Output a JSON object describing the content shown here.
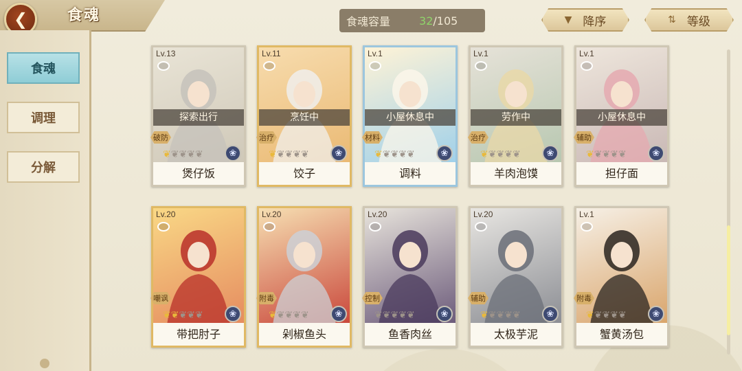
{
  "header": {
    "title": "食魂",
    "capacity_label": "食魂容量",
    "capacity_current": "32",
    "capacity_max": "/105",
    "sort_order_label": "降序",
    "sort_key_label": "等级"
  },
  "sidebar": {
    "items": [
      {
        "label": "食魂",
        "active": true
      },
      {
        "label": "调理",
        "active": false
      },
      {
        "label": "分解",
        "active": false
      }
    ]
  },
  "cards": [
    {
      "level": "Lv.13",
      "status": "探索出行",
      "role": "破防",
      "stars_lit": 1,
      "stars_total": 5,
      "name": "煲仔饭",
      "rarity": "grey"
    },
    {
      "level": "Lv.11",
      "status": "烹饪中",
      "role": "治疗",
      "stars_lit": 1,
      "stars_total": 5,
      "name": "饺子",
      "rarity": "gold"
    },
    {
      "level": "Lv.1",
      "status": "小屋休息中",
      "role": "材料",
      "stars_lit": 1,
      "stars_total": 5,
      "name": "调料",
      "rarity": "blue"
    },
    {
      "level": "Lv.1",
      "status": "劳作中",
      "role": "治疗",
      "stars_lit": 1,
      "stars_total": 5,
      "name": "羊肉泡馍",
      "rarity": "grey"
    },
    {
      "level": "Lv.1",
      "status": "小屋休息中",
      "role": "辅助",
      "stars_lit": 1,
      "stars_total": 5,
      "name": "担仔面",
      "rarity": "grey"
    },
    {
      "level": "Lv.20",
      "status": "",
      "role": "嘲讽",
      "stars_lit": 2,
      "stars_total": 5,
      "name": "带把肘子",
      "rarity": "gold"
    },
    {
      "level": "Lv.20",
      "status": "",
      "role": "附毒",
      "stars_lit": 1,
      "stars_total": 5,
      "name": "剁椒鱼头",
      "rarity": "gold"
    },
    {
      "level": "Lv.20",
      "status": "",
      "role": "控制",
      "stars_lit": 0,
      "stars_total": 5,
      "name": "鱼香肉丝",
      "rarity": "grey"
    },
    {
      "level": "Lv.20",
      "status": "",
      "role": "辅助",
      "stars_lit": 1,
      "stars_total": 5,
      "name": "太极芋泥",
      "rarity": "grey"
    },
    {
      "level": "Lv.1",
      "status": "",
      "role": "附毒",
      "stars_lit": 1,
      "stars_total": 5,
      "name": "蟹黄汤包",
      "rarity": "grey"
    }
  ],
  "colors": {
    "accent_green": "#8fd46a",
    "nav_active": "#8fcdd6",
    "gold_border": "#e0b964",
    "blue_border": "#9cc6de"
  }
}
